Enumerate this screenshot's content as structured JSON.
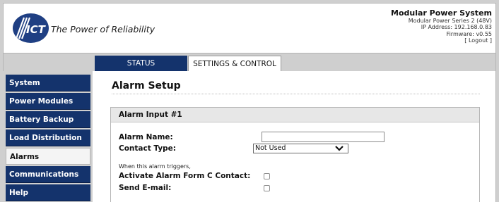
{
  "header": {
    "logo_letters": "ICT",
    "tagline": "The Power of Reliability",
    "system_title": "Modular Power System",
    "series": "Modular Power Series 2 (48V)",
    "ip_address": "IP Address: 192.168.0.83",
    "firmware": "Firmware: v0.55",
    "logout": "[ Logout ]"
  },
  "tabs": [
    {
      "label": "STATUS",
      "active": false
    },
    {
      "label": "SETTINGS & CONTROL",
      "active": true
    }
  ],
  "sidebar": {
    "items": [
      {
        "label": "System"
      },
      {
        "label": "Power Modules"
      },
      {
        "label": "Battery Backup"
      },
      {
        "label": "Load Distribution"
      },
      {
        "label": "Alarms",
        "active": true
      },
      {
        "label": "Communications"
      },
      {
        "label": "Help"
      }
    ]
  },
  "main": {
    "title": "Alarm Setup",
    "panel_title": "Alarm Input #1",
    "alarm_name_label": "Alarm Name:",
    "alarm_name_value": "",
    "contact_type_label": "Contact Type:",
    "contact_type_value": "Not Used",
    "trigger_note": "When this alarm triggers,",
    "form_c_label": "Activate Alarm Form C Contact:",
    "form_c_checked": false,
    "email_label": "Send E-mail:",
    "email_checked": false
  },
  "colors": {
    "nav_blue": "#14336c",
    "logo_blue": "#1f3f83",
    "frame_gray": "#cfcfcf"
  }
}
